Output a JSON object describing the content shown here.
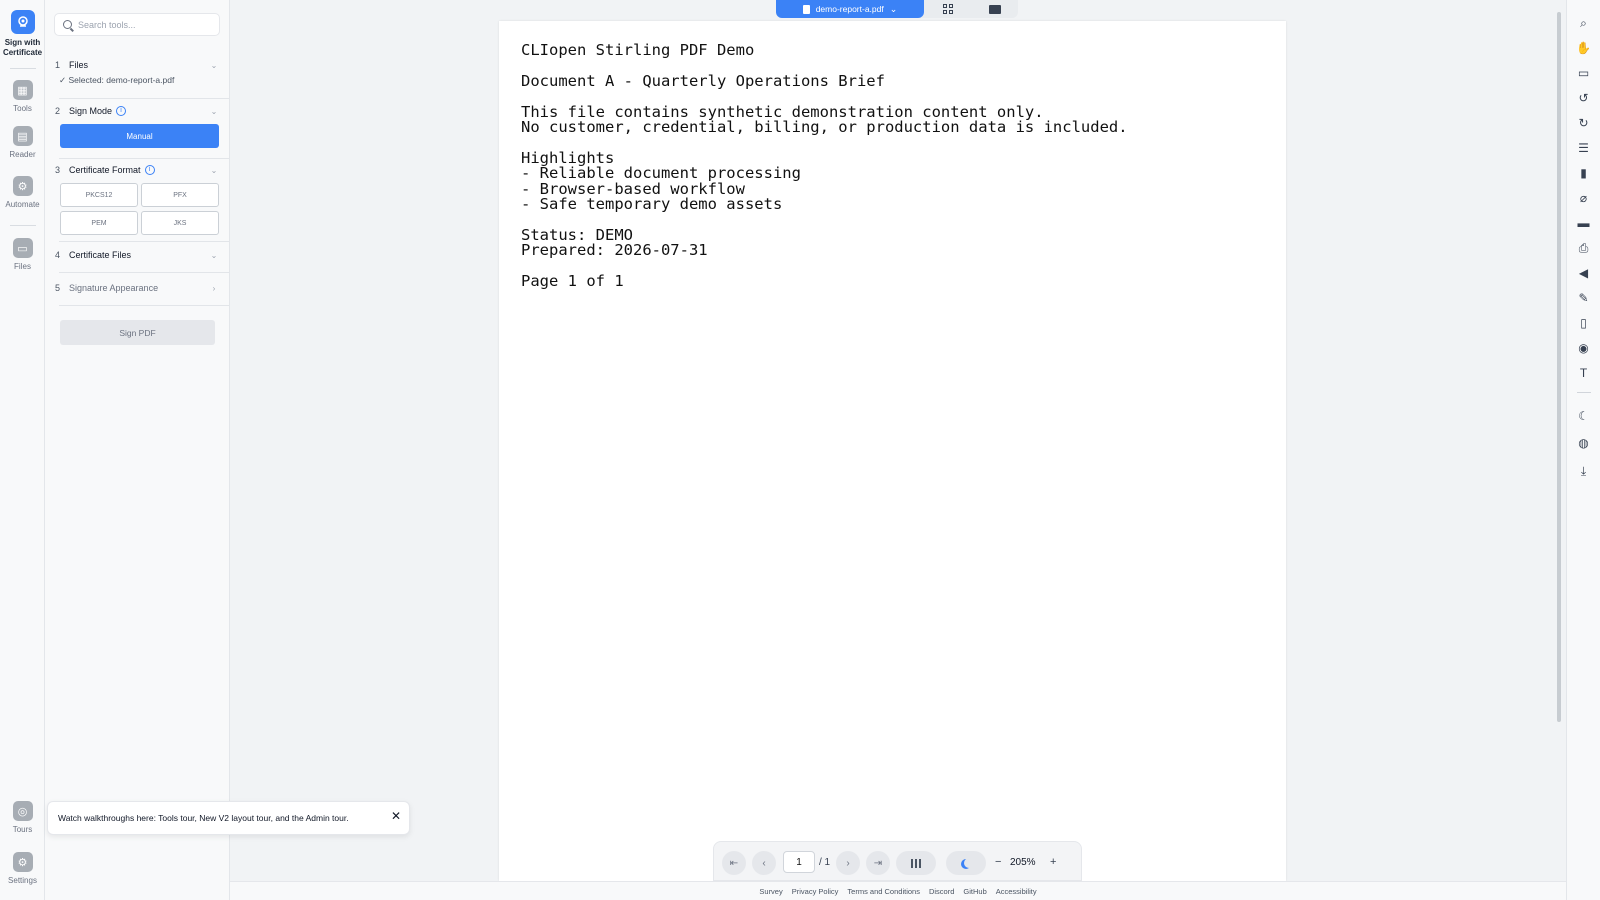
{
  "app": {
    "active_tool_label": "Sign with Certificate"
  },
  "rail": {
    "items": [
      {
        "label": "Tools"
      },
      {
        "label": "Reader"
      },
      {
        "label": "Automate"
      },
      {
        "label": "Files"
      },
      {
        "label": "Tours"
      },
      {
        "label": "Settings"
      }
    ]
  },
  "panel": {
    "search_placeholder": "Search tools...",
    "steps": [
      {
        "num": "1",
        "title": "Files",
        "note": "✓ Selected: demo-report-a.pdf"
      },
      {
        "num": "2",
        "title": "Sign Mode",
        "mode_button": "Manual"
      },
      {
        "num": "3",
        "title": "Certificate Format",
        "formats": [
          "PKCS12",
          "PFX",
          "PEM",
          "JKS"
        ]
      },
      {
        "num": "4",
        "title": "Certificate Files"
      },
      {
        "num": "5",
        "title": "Signature Appearance"
      }
    ],
    "sign_button": "Sign PDF"
  },
  "toast": {
    "text": "Watch walkthroughs here: Tools tour, New V2 layout tour, and the Admin tour.",
    "close": "✕"
  },
  "viewer": {
    "file_name": "demo-report-a.pdf",
    "page_text": "CLIopen Stirling PDF Demo\n\nDocument A - Quarterly Operations Brief\n\nThis file contains synthetic demonstration content only.\nNo customer, credential, billing, or production data is included.\n\nHighlights\n- Reliable document processing\n- Browser-based workflow\n- Safe temporary demo assets\n\nStatus: DEMO\nPrepared: 2026-07-31\n\nPage 1 of 1"
  },
  "nav": {
    "current_page": "1",
    "total_pages": "/ 1",
    "zoom": "205%",
    "zoom_out": "−",
    "zoom_in": "+"
  },
  "footer": {
    "links": [
      "Survey",
      "Privacy Policy",
      "Terms and Conditions",
      "Discord",
      "GitHub",
      "Accessibility"
    ]
  },
  "right_rail_icons": [
    "search-icon",
    "pan-hand-icon",
    "ruler-icon",
    "rotate-left-icon",
    "rotate-right-icon",
    "list-icon",
    "bookmark-icon",
    "attachment-icon",
    "comment-icon",
    "print-icon",
    "speaker-icon",
    "pen-icon",
    "file-edit-icon",
    "eye-icon",
    "text-size-icon",
    "dark-mode-icon",
    "globe-icon",
    "download-icon"
  ],
  "colors": {
    "accent": "#3b82f6",
    "background": "#f1f3f5"
  }
}
